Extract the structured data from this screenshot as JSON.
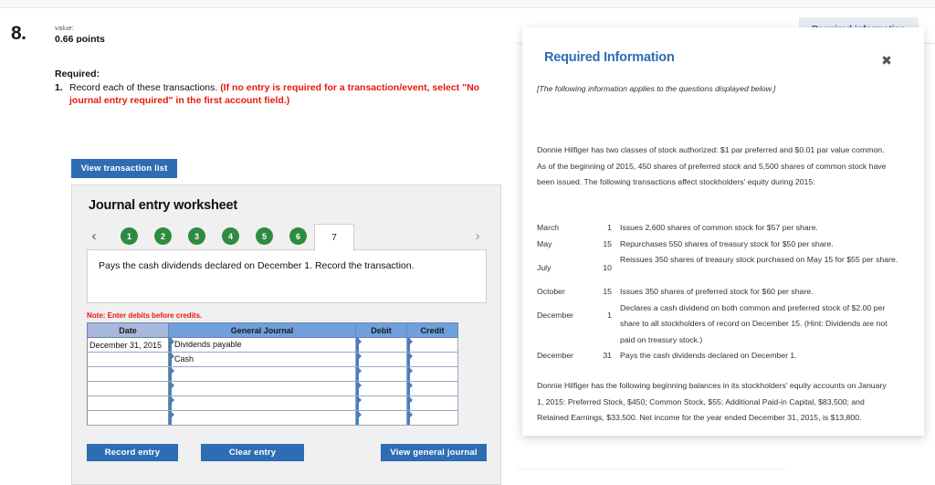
{
  "header": {
    "question_number": "8.",
    "value_label": "value:",
    "points": "0.66 points",
    "required_info_tab": "Required information"
  },
  "required": {
    "title": "Required:",
    "item_number": "1.",
    "item_text": "Record each of these transactions. ",
    "item_text_red": "(If no entry is required for a transaction/event, select \"No journal entry required\" in the first account field.)"
  },
  "buttons": {
    "view_transaction_list": "View transaction list",
    "record_entry": "Record entry",
    "clear_entry": "Clear entry",
    "view_general_journal": "View general journal"
  },
  "worksheet": {
    "title": "Journal entry worksheet",
    "prev_arrow": "‹",
    "next_arrow": "›",
    "pages": [
      "1",
      "2",
      "3",
      "4",
      "5",
      "6"
    ],
    "active_page": "7",
    "transaction_text": "Pays the cash dividends declared on December 1. Record the transaction.",
    "note": "Note: Enter debits before credits."
  },
  "journal_table": {
    "columns": [
      "Date",
      "General Journal",
      "Debit",
      "Credit"
    ],
    "rows": [
      {
        "date": "December 31, 2015",
        "account": "Dividends payable",
        "debit": "",
        "credit": ""
      },
      {
        "date": "",
        "account": "Cash",
        "debit": "",
        "credit": ""
      },
      {
        "date": "",
        "account": "",
        "debit": "",
        "credit": ""
      },
      {
        "date": "",
        "account": "",
        "debit": "",
        "credit": ""
      },
      {
        "date": "",
        "account": "",
        "debit": "",
        "credit": ""
      },
      {
        "date": "",
        "account": "",
        "debit": "",
        "credit": ""
      }
    ]
  },
  "modal": {
    "title": "Required Information",
    "close_icon": "✖",
    "intro": "[The following information applies to the questions displayed below.]",
    "paragraph_1": "Donnie Hilfiger has two classes of stock authorized: $1 par preferred and $0.01 par value common. As of the beginning of 2015, 450 shares of preferred stock and 5,500 shares of common stock have been issued. The following transactions affect stockholders' equity during 2015:",
    "transactions": [
      {
        "month": "March",
        "day": "1",
        "desc": "Issues 2,600 shares of common stock for $57 per share.",
        "tall": false
      },
      {
        "month": "May",
        "day": "15",
        "desc": "Repurchases 550 shares of treasury stock for $50 per share.",
        "tall": false
      },
      {
        "month": "July",
        "day": "10",
        "desc": "Reissues 350 shares of treasury stock purchased on May 15 for $55 per share.",
        "tall": true
      },
      {
        "month": "October",
        "day": "15",
        "desc": "Issues 350 shares of preferred stock for $60 per share.",
        "tall": false
      },
      {
        "month": "December",
        "day": "1",
        "desc": "Declares a cash dividend on both common and preferred stock of $2.00 per share to all stockholders of record on December 15. (Hint: Dividends are not paid on treasury stock.)",
        "tall": true
      },
      {
        "month": "December",
        "day": "31",
        "desc": "Pays the cash dividends declared on December 1.",
        "tall": false
      }
    ],
    "paragraph_2": "Donnie Hilfiger has the following beginning balances in its stockholders' equity accounts on January 1, 2015: Preferred Stock, $450; Common Stock, $55; Additional Paid-in Capital, $83,500; and Retained Earnings, $33,500. Net income for the year ended December 31, 2015, is $13,800."
  },
  "colors": {
    "primary_button": "#2e6db4",
    "pager_green": "#2e8b40",
    "alert_red": "#e8180c",
    "table_header_blue": "#6f9fdd",
    "table_header_date": "#a8b8dc",
    "modal_title_blue": "#2e6db4"
  }
}
